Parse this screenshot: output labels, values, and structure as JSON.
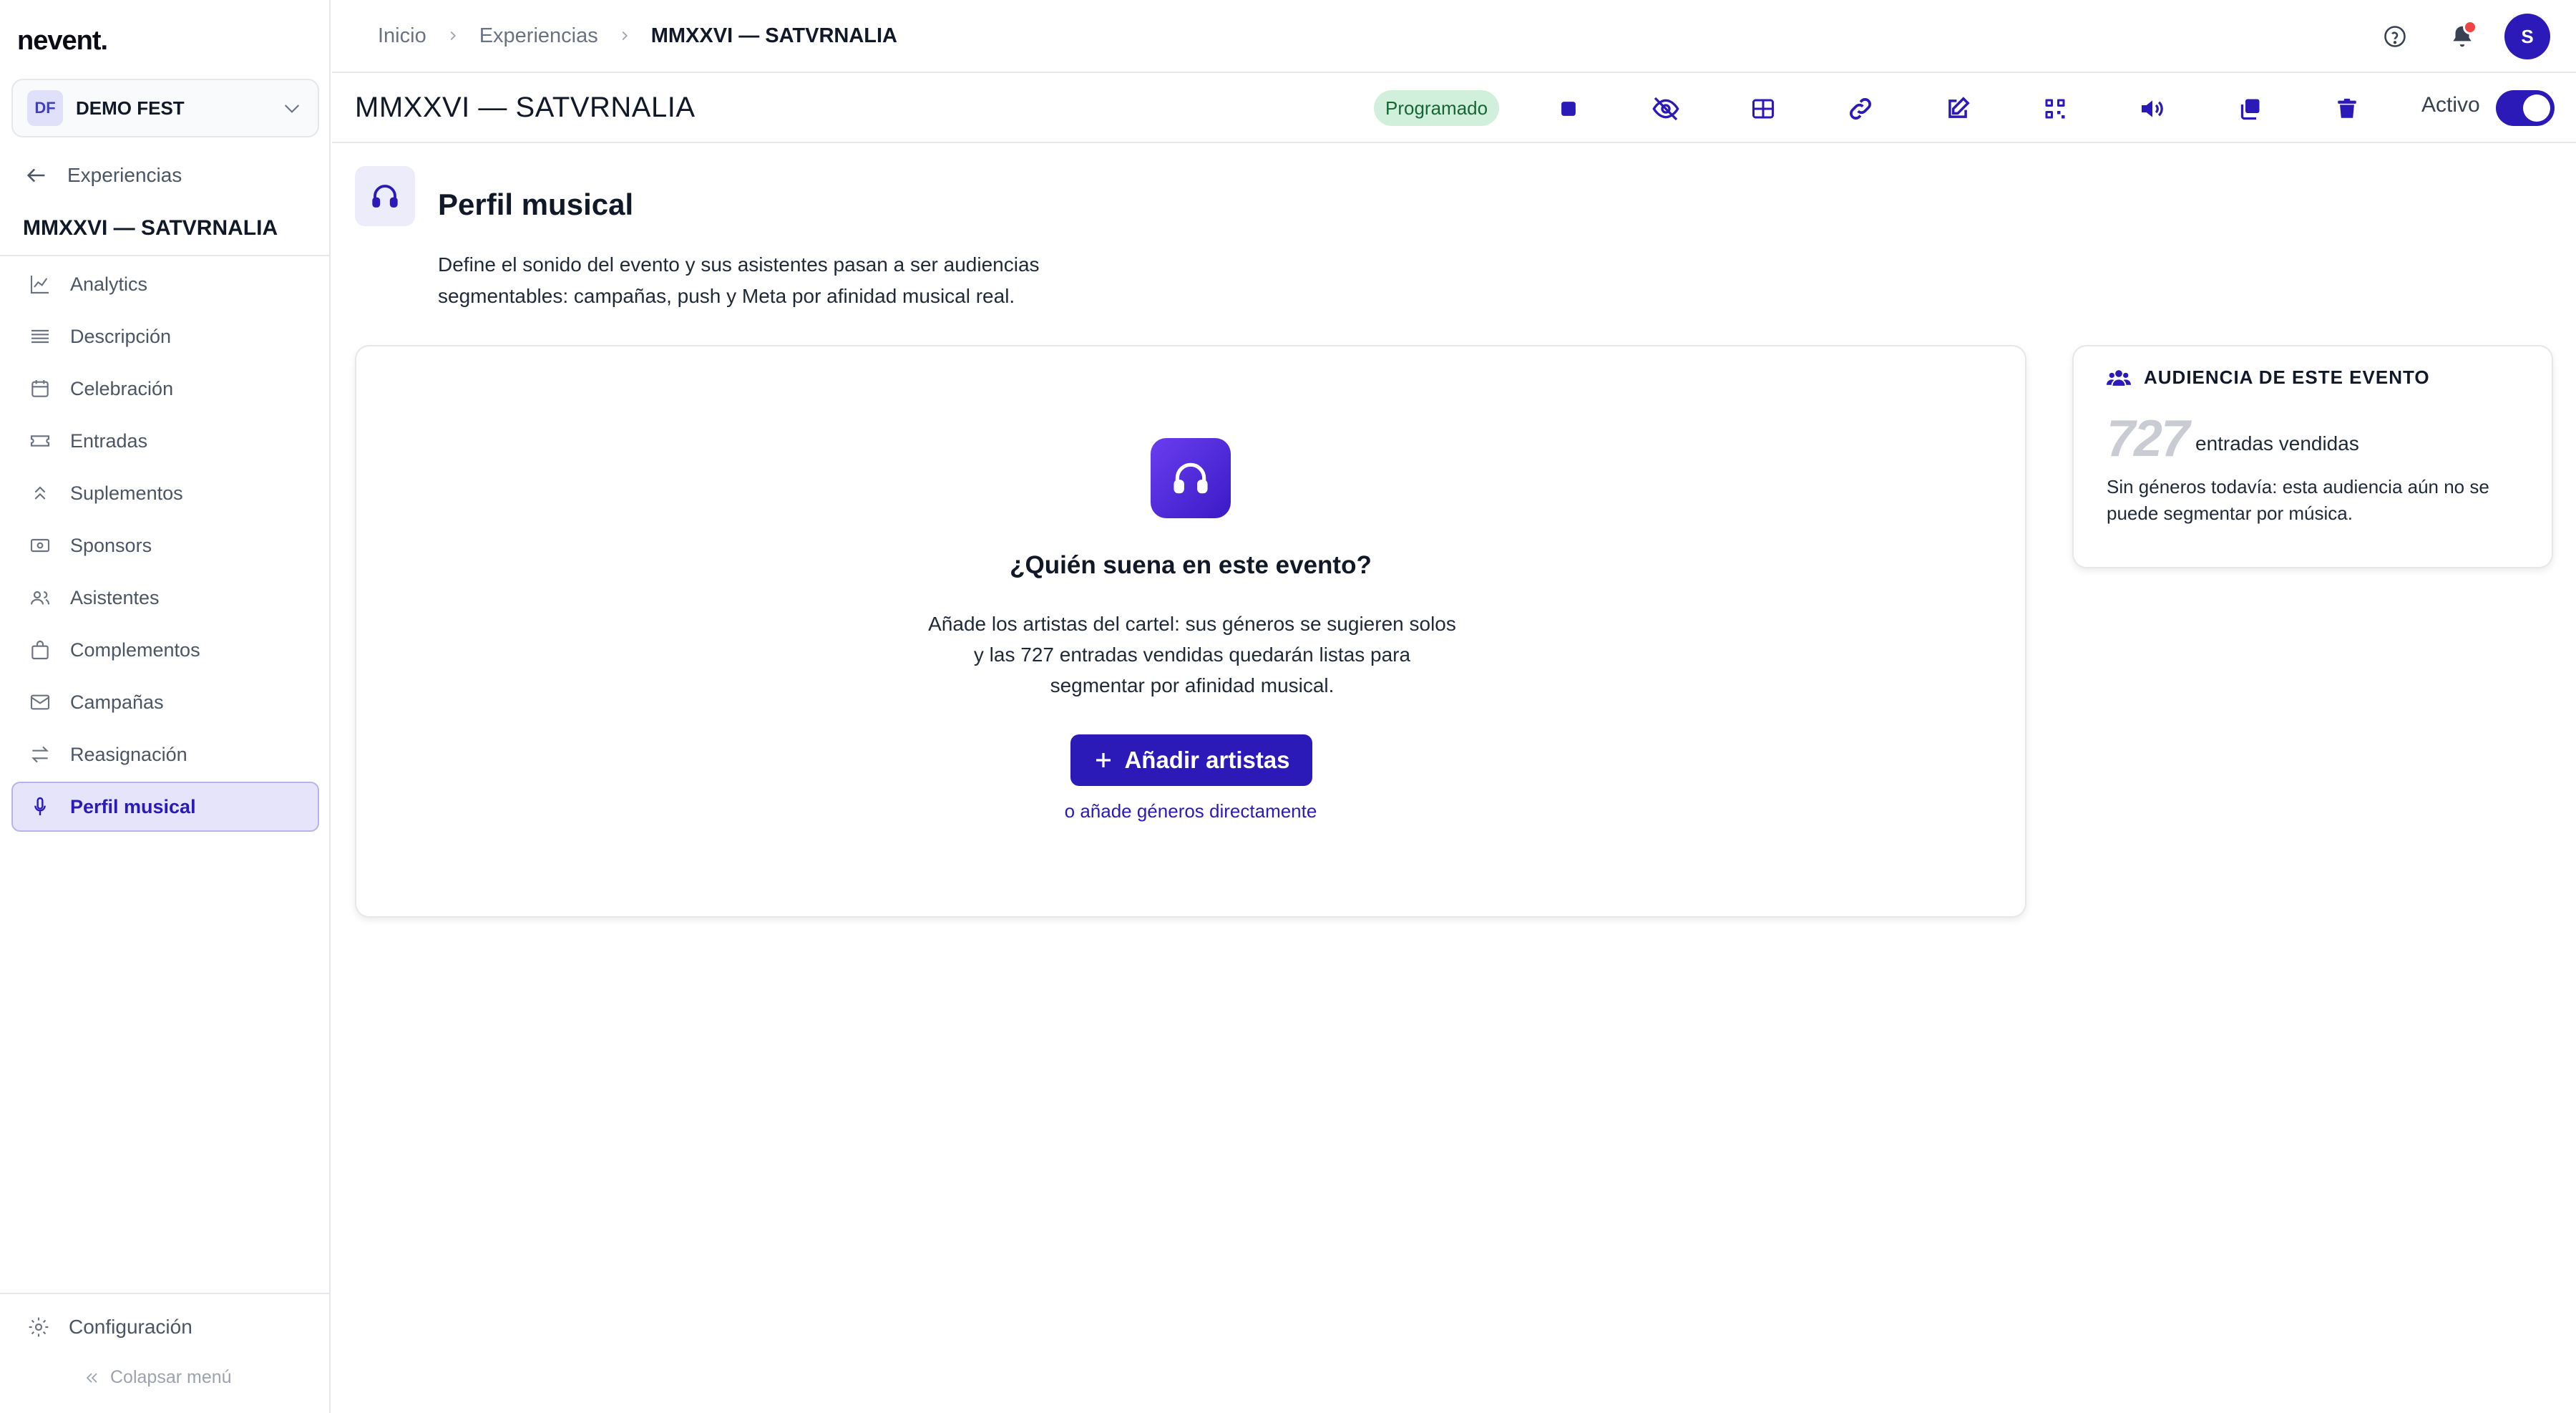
{
  "app": {
    "logo": "nevent."
  },
  "sidebar": {
    "org": {
      "initials": "DF",
      "name": "DEMO FEST"
    },
    "back_label": "Experiencias",
    "event_title": "MMXXVI — SATVRNALIA",
    "items": [
      {
        "label": "Analytics",
        "icon": "chart-line-icon"
      },
      {
        "label": "Descripción",
        "icon": "list-lines-icon"
      },
      {
        "label": "Celebración",
        "icon": "calendar-icon"
      },
      {
        "label": "Entradas",
        "icon": "ticket-icon"
      },
      {
        "label": "Suplementos",
        "icon": "chevrons-up-icon"
      },
      {
        "label": "Sponsors",
        "icon": "banknote-icon"
      },
      {
        "label": "Asistentes",
        "icon": "users-icon"
      },
      {
        "label": "Complementos",
        "icon": "shopping-bag-icon"
      },
      {
        "label": "Campañas",
        "icon": "mail-icon"
      },
      {
        "label": "Reasignación",
        "icon": "arrows-swap-icon"
      },
      {
        "label": "Perfil musical",
        "icon": "microphone-icon",
        "active": true
      }
    ],
    "settings_label": "Configuración",
    "collapse_label": "Colapsar menú"
  },
  "topbar": {
    "breadcrumb": [
      "Inicio",
      "Experiencias",
      "MMXXVI — SATVRNALIA"
    ],
    "avatar_initial": "S"
  },
  "subheader": {
    "title": "MMXXVI — SATVRNALIA",
    "status": "Programado",
    "active_label": "Activo",
    "active": true,
    "tools": [
      "stop-icon",
      "eye-off-icon",
      "table-icon",
      "link-icon",
      "edit-icon",
      "qr-code-icon",
      "speaker-icon",
      "duplicate-icon",
      "trash-icon"
    ]
  },
  "section": {
    "title": "Perfil musical",
    "description_line1": "Define el sonido del evento y sus asistentes pasan a ser audiencias",
    "description_line2": "segmentables: campañas, push y Meta por afinidad musical real."
  },
  "empty_state": {
    "heading": "¿Quién suena en este evento?",
    "text_line1": "Añade los artistas del cartel: sus géneros se sugieren solos",
    "text_line2": "y las 727 entradas vendidas quedarán listas para",
    "text_line3": "segmentar por afinidad musical.",
    "button_label": "Añadir artistas",
    "link_label": "o añade géneros directamente"
  },
  "audience": {
    "heading": "AUDIENCIA DE ESTE EVENTO",
    "count": "727",
    "count_label": "entradas vendidas",
    "note": "Sin géneros todavía: esta audiencia aún no se puede segmentar por música."
  },
  "colors": {
    "accent": "#2c1ab8",
    "accent_light": "#e6e4fb",
    "status_bg": "#d1f0dc",
    "status_text": "#166534",
    "notification": "#ef4444"
  }
}
